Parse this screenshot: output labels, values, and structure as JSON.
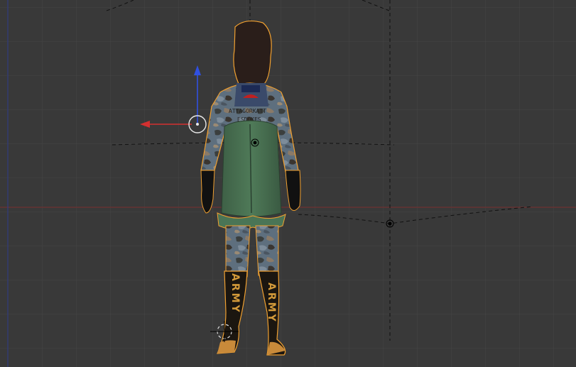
{
  "app": "3D viewport",
  "colors": {
    "background": "#393939",
    "grid": "#4a4a4a",
    "x_axis": "#8a2a2a",
    "y_axis": "#2a2a8a",
    "selection_outline": "#f0a030",
    "manipulator_x": "#d43030",
    "manipulator_z": "#3050e0"
  },
  "icons": {
    "manipulator": "translate-manipulator-icon",
    "cursor": "3d-cursor-icon",
    "origin": "object-origin-icon"
  },
  "model": {
    "legs_text_left": "ARMY",
    "legs_text_right": "ARMY",
    "back_patch_line1": "ATTAGORKATT",
    "back_patch_line2": "ESDOKES"
  }
}
